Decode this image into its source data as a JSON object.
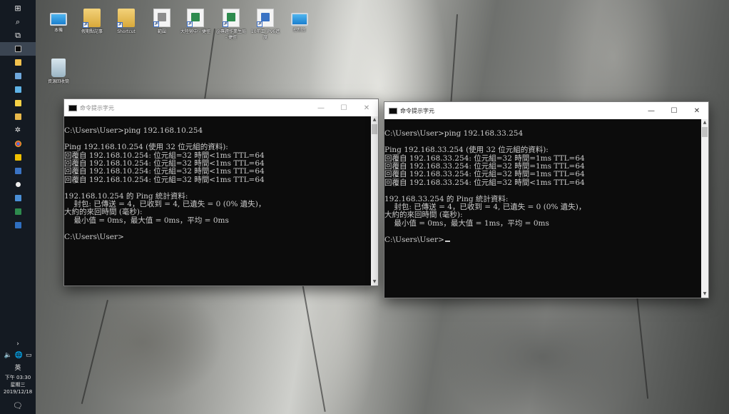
{
  "taskbar": {
    "start_glyph": "⊞",
    "search_glyph": "⌕",
    "taskview_glyph": "⧉",
    "show_hidden_glyph": "›",
    "volume_glyph": "🔈",
    "network_glyph": "🌐",
    "battery_glyph": "▭",
    "ime_label": "英",
    "time": "下午 03:30",
    "weekday": "星期三",
    "date": "2019/12/18",
    "notification_glyph": "🗨"
  },
  "desktop_icons": [
    {
      "label": "本機",
      "icon": "this-pc-icon"
    },
    {
      "label": "假期點記事",
      "icon": "folder-icon"
    },
    {
      "label": "Shortcut",
      "icon": "folder-icon"
    },
    {
      "label": "範圍",
      "icon": "document-icon"
    },
    {
      "label": "大陸勞中 - 捷徑",
      "icon": "document-icon"
    },
    {
      "label": "@專題作業生局 - 捷徑",
      "icon": "document-icon"
    },
    {
      "label": "10年工 iPv6進度",
      "icon": "document-icon"
    },
    {
      "label": "控制台",
      "icon": "control-panel-icon"
    },
    {
      "label": "資源回收筒",
      "icon": "recycle-bin-icon"
    }
  ],
  "windows": [
    {
      "title": "命令提示字元",
      "state": "inactive",
      "lines": [
        "",
        "C:\\Users\\User>ping 192.168.10.254",
        "",
        "Ping 192.168.10.254 (使用 32 位元組的資料):",
        "回覆自 192.168.10.254: 位元組=32 時間<1ms TTL=64",
        "回覆自 192.168.10.254: 位元組=32 時間<1ms TTL=64",
        "回覆自 192.168.10.254: 位元組=32 時間<1ms TTL=64",
        "回覆自 192.168.10.254: 位元組=32 時間<1ms TTL=64",
        "",
        "192.168.10.254 的 Ping 統計資料:",
        "    封包: 已傳送 = 4，已收到 = 4, 已遺失 = 0 (0% 遺失)，",
        "大約的來回時間 (毫秒):",
        "    最小值 = 0ms，最大值 = 0ms，平均 = 0ms",
        "",
        "C:\\Users\\User>"
      ]
    },
    {
      "title": "命令提示字元",
      "state": "active",
      "lines": [
        "",
        "C:\\Users\\User>ping 192.168.33.254",
        "",
        "Ping 192.168.33.254 (使用 32 位元組的資料):",
        "回覆自 192.168.33.254: 位元組=32 時間=1ms TTL=64",
        "回覆自 192.168.33.254: 位元組=32 時間=1ms TTL=64",
        "回覆自 192.168.33.254: 位元組=32 時間=1ms TTL=64",
        "回覆自 192.168.33.254: 位元組=32 時間<1ms TTL=64",
        "",
        "192.168.33.254 的 Ping 統計資料:",
        "    封包: 已傳送 = 4，已收到 = 4, 已遺失 = 0 (0% 遺失)，",
        "大約的來回時間 (毫秒):",
        "    最小值 = 0ms，最大值 = 1ms，平均 = 0ms",
        "",
        "C:\\Users\\User>"
      ]
    }
  ],
  "window_controls": {
    "minimize": "—",
    "maximize": "☐",
    "close": "✕"
  }
}
